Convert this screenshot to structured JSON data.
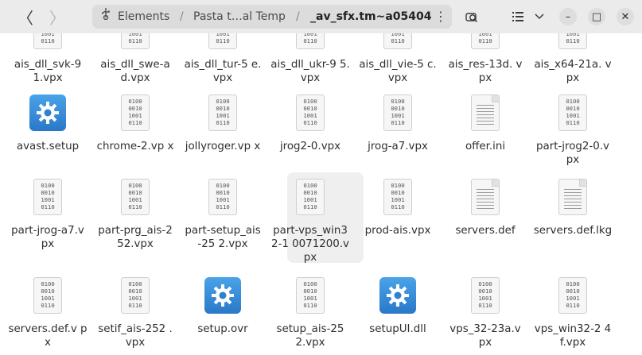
{
  "header": {
    "back_glyph": "〈",
    "forward_glyph": "〉",
    "path": {
      "root_label": "Elements",
      "separator": "/",
      "middle_label": "Pasta t…al Temp",
      "current_label": "_av_sfx.tm~a05404"
    },
    "menu_glyph": "⋮",
    "minimize_glyph": "–",
    "maximize_glyph": "□",
    "close_glyph": "✕"
  },
  "files": [
    {
      "name": "ais_dll_svk-9 1.vpx",
      "type": "binary"
    },
    {
      "name": "ais_dll_swe-ad.vpx",
      "type": "binary"
    },
    {
      "name": "ais_dll_tur-5 e.vpx",
      "type": "binary"
    },
    {
      "name": "ais_dll_ukr-9 5.vpx",
      "type": "binary"
    },
    {
      "name": "ais_dll_vie-5 c.vpx",
      "type": "binary"
    },
    {
      "name": "ais_res-13d. vpx",
      "type": "binary"
    },
    {
      "name": "ais_x64-21a. vpx",
      "type": "binary"
    },
    {
      "name": "avast.setup",
      "type": "executable"
    },
    {
      "name": "chrome-2.vp x",
      "type": "binary"
    },
    {
      "name": "jollyroger.vp x",
      "type": "binary"
    },
    {
      "name": "jrog2-0.vpx",
      "type": "binary"
    },
    {
      "name": "jrog-a7.vpx",
      "type": "binary"
    },
    {
      "name": "offer.ini",
      "type": "text"
    },
    {
      "name": "part-jrog2-0.vpx",
      "type": "binary"
    },
    {
      "name": "part-jrog-a7.vpx",
      "type": "binary"
    },
    {
      "name": "part-prg_ais-252.vpx",
      "type": "binary"
    },
    {
      "name": "part-setup_ais-25 2.vpx",
      "type": "binary"
    },
    {
      "name": "part-vps_win32-1 0071200.vpx",
      "type": "binary",
      "selected": true
    },
    {
      "name": "prod-ais.vpx",
      "type": "binary"
    },
    {
      "name": "servers.def",
      "type": "text"
    },
    {
      "name": "servers.def.lkg",
      "type": "text"
    },
    {
      "name": "servers.def.v px",
      "type": "binary"
    },
    {
      "name": "setif_ais-252 .vpx",
      "type": "binary"
    },
    {
      "name": "setup.ovr",
      "type": "executable"
    },
    {
      "name": "setup_ais-25 2.vpx",
      "type": "binary"
    },
    {
      "name": "setupUI.dll",
      "type": "executable"
    },
    {
      "name": "vps_32-23a.v px",
      "type": "binary"
    },
    {
      "name": "vps_win32-2 4f.vpx",
      "type": "binary"
    }
  ],
  "binary_icon_text": [
    "0100",
    "0010",
    "1001",
    "0110"
  ],
  "colors": {
    "accent": "#2a78c8",
    "header_bg": "#ebebeb",
    "pathbar_bg": "#dcdcdc"
  }
}
